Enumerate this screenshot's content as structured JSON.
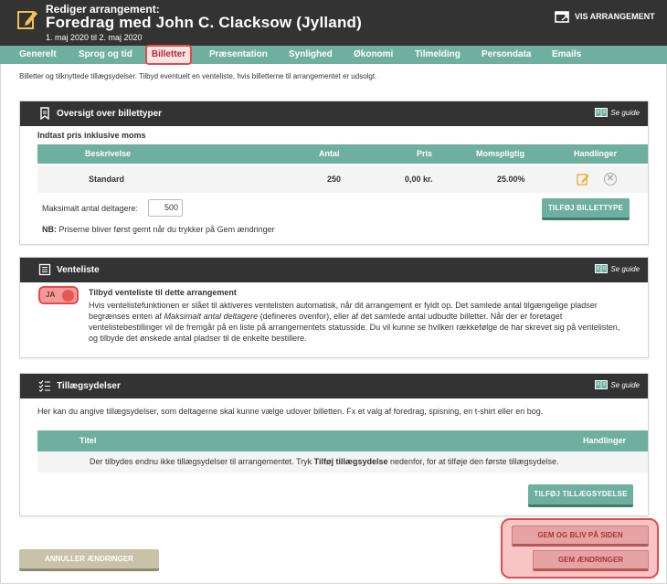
{
  "header": {
    "small_title": "Rediger arrangement:",
    "title": "Foredrag med John C. Clacksow (Jylland)",
    "dates": "1. maj 2020 til 2. maj 2020",
    "vis_label": "VIS ARRANGEMENT",
    "icon": "edit-note-icon"
  },
  "tabs": [
    {
      "label": "Generelt"
    },
    {
      "label": "Sprog og tid"
    },
    {
      "label": "Billetter",
      "active": true
    },
    {
      "label": "Præsentation"
    },
    {
      "label": "Synlighed"
    },
    {
      "label": "Økonomi"
    },
    {
      "label": "Tilmelding"
    },
    {
      "label": "Persondata"
    },
    {
      "label": "Emails"
    }
  ],
  "intro": "Billetter og tilknyttede tillægsydelser. Tilbyd eventuelt en venteliste, hvis billetterne til arrangementet er udsolgt.",
  "guide_label": "Se guide",
  "ticket_panel": {
    "title": "Oversigt over billettyper",
    "subhead": "Indtast pris inklusive moms",
    "columns": [
      "Beskrivelse",
      "Antal",
      "Pris",
      "Momspligtig",
      "Handlinger"
    ],
    "rows": [
      {
        "beskrivelse": "Standard",
        "antal": "250",
        "pris": "0,00 kr.",
        "momspligtig": "25.00%"
      }
    ],
    "max_label": "Maksimalt antal deltagere:",
    "max_value": "500",
    "nb_bold": "NB:",
    "nb_text": " Priserne bliver først gemt når du trykker på Gem ændringer",
    "add_button": "TILFØJ BILLETTYPE"
  },
  "waitlist_panel": {
    "title": "Venteliste",
    "toggle_label": "JA",
    "heading": "Tilbyd venteliste til dette arrangement",
    "text_before": "Hvis ventelistefunktionen er slået til aktiveres ventelisten automatisk, når dit arrangement er fyldt op. Det samlede antal tilgængelige pladser begrænses enten af ",
    "text_em": "Maksimalt antal deltagere",
    "text_after": " (defineres ovenfor), eller af det samlede antal udbudte billetter. Når der er foretaget ventelistebestillinger vil de fremgår på en liste på arrangementets statusside. Du vil kunne se hvilken rækkefølge de har skrevet sig på ventelisten, og tilbyde det ønskede antal pladser til de enkelte bestillere."
  },
  "addon_panel": {
    "title": "Tillægsydelser",
    "text": "Her kan du angive tillægsydelser, som deltagerne skal kunne vælge udover billetten. Fx et valg af foredrag, spisning, en t-shirt eller en bog.",
    "columns": [
      "Titel",
      "Handlinger"
    ],
    "empty_before": "Der tilbydes endnu ikke tillægsydelser til arrangementet. Tryk ",
    "empty_bold": "Tilføj tillægsydelse",
    "empty_after": " nedenfor, for at tilføje den første tillægsydelse.",
    "add_button": "TILFØJ TILLÆGSYDELSE"
  },
  "footer": {
    "cancel": "ANNULLER ÆNDRINGER",
    "save_stay": "GEM OG BLIV PÅ SIDEN",
    "save": "GEM ÆNDRINGER"
  },
  "colors": {
    "dark": "#333333",
    "teal": "#6eafa0",
    "highlight": "#e24b4b"
  }
}
